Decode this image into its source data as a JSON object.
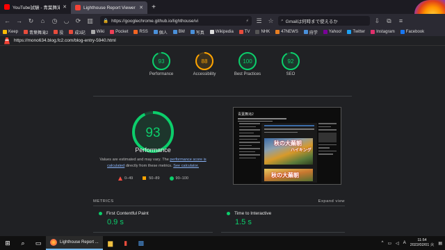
{
  "browser": {
    "tabs": [
      {
        "title": "YouTube試験 - 青葉舞滝2 - ",
        "favicon_color": "#ff0000",
        "active": false
      },
      {
        "title": "Lighthouse Report Viewer",
        "favicon_color": "#f44336",
        "active": true
      }
    ],
    "url": "https://googlechrome.github.io/lighthouse/vi",
    "search_text": "Gmailは何時まで使えるか",
    "bookmarks": [
      {
        "label": "Keep",
        "color": "#fbbc04"
      },
      {
        "label": "青葉舞滝2",
        "color": "#e74c3c"
      },
      {
        "label": "投",
        "color": "#e74c3c"
      },
      {
        "label": "成3記",
        "color": "#e74c3c"
      },
      {
        "label": "Wiki",
        "color": "#aaaaaa"
      },
      {
        "label": "Pocket",
        "color": "#ef4056"
      },
      {
        "label": "RSS",
        "color": "#f26522"
      },
      {
        "label": "個人",
        "color": "#4a90d9"
      },
      {
        "label": "BM",
        "color": "#4a90d9"
      },
      {
        "label": "写真",
        "color": "#4a90d9"
      },
      {
        "label": "Wikipedia",
        "color": "#dddddd"
      },
      {
        "label": "TV",
        "color": "#e74c3c"
      },
      {
        "label": "NHK",
        "color": "#555555"
      },
      {
        "label": "47NEWS",
        "color": "#e67e22"
      },
      {
        "label": "府学",
        "color": "#4a90d9"
      },
      {
        "label": "Yahoo!",
        "color": "#7b0099"
      },
      {
        "label": "Twitter",
        "color": "#1da1f2"
      },
      {
        "label": "Instagram",
        "color": "#e1306c"
      },
      {
        "label": "Facebook",
        "color": "#1877f2"
      }
    ]
  },
  "report": {
    "tested_url": "https://mono634.blog.fc2.com/blog-entry-5940.html",
    "categories": [
      {
        "score": "93",
        "label": "Performance",
        "color": "#0cce6b",
        "value": 93
      },
      {
        "score": "88",
        "label": "Accessibility",
        "color": "#ffa400",
        "value": 88
      },
      {
        "score": "100",
        "label": "Best Practices",
        "color": "#0cce6b",
        "value": 100
      },
      {
        "score": "92",
        "label": "SEO",
        "color": "#0cce6b",
        "value": 92
      }
    ],
    "main_score": "93",
    "main_score_value": 93,
    "main_title": "Performance",
    "note_pre": "Values are estimated and may vary. The ",
    "note_link1": "performance score is calculated",
    "note_mid": " directly from these metrics. ",
    "note_link2": "See calculator.",
    "legend": [
      {
        "range": "0–49",
        "color": "#ff4e42",
        "shape": "triangle"
      },
      {
        "range": "50–89",
        "color": "#ffa400",
        "shape": "square"
      },
      {
        "range": "90–100",
        "color": "#0cce6b",
        "shape": "circle"
      }
    ],
    "screenshot": {
      "blog_title": "青葉舞滝2",
      "caption1": "秋の大蕪朝",
      "caption2": "ハイキング",
      "caption3": "秋の大蕪朝"
    },
    "metrics_label": "METRICS",
    "expand_label": "Expand view",
    "metrics": [
      {
        "label": "First Contentful Paint",
        "value": "0.9 s"
      },
      {
        "label": "Time to Interactive",
        "value": "1.5 s"
      }
    ]
  },
  "taskbar": {
    "app_label": "Lighthouse Report ...",
    "ime": "A",
    "time": "11:54",
    "date": "2022/02/01 火"
  }
}
